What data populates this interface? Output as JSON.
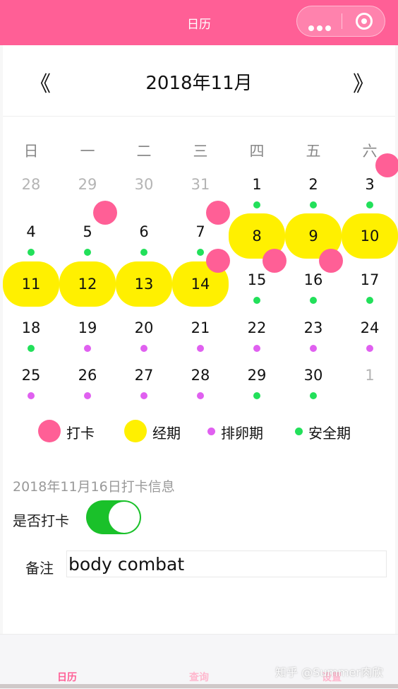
{
  "navbar": {
    "title": "日历",
    "bg": "#ff5f96"
  },
  "calendar": {
    "month_title": "2018年11月",
    "prev_arrow": "《",
    "next_arrow": "》",
    "weekdays": [
      "日",
      "一",
      "二",
      "三",
      "四",
      "五",
      "六"
    ],
    "days": [
      {
        "label": "28",
        "other": true
      },
      {
        "label": "29",
        "other": true
      },
      {
        "label": "30",
        "other": true
      },
      {
        "label": "31",
        "other": true
      },
      {
        "label": "1",
        "dot": "green"
      },
      {
        "label": "2",
        "dot": "green"
      },
      {
        "label": "3",
        "dot": "green",
        "mark": true
      },
      {
        "label": "4",
        "dot": "green"
      },
      {
        "label": "5",
        "dot": "green",
        "mark": true
      },
      {
        "label": "6",
        "dot": "green"
      },
      {
        "label": "7",
        "dot": "green",
        "mark": true
      },
      {
        "label": "8",
        "period": true
      },
      {
        "label": "9",
        "period": true
      },
      {
        "label": "10",
        "period": true
      },
      {
        "label": "11",
        "period": true
      },
      {
        "label": "12",
        "period": true
      },
      {
        "label": "13",
        "period": true
      },
      {
        "label": "14",
        "period": true,
        "mark": true
      },
      {
        "label": "15",
        "dot": "green",
        "mark": true
      },
      {
        "label": "16",
        "dot": "green",
        "mark": true
      },
      {
        "label": "17",
        "dot": "green"
      },
      {
        "label": "18",
        "dot": "green"
      },
      {
        "label": "19",
        "dot": "purple"
      },
      {
        "label": "20",
        "dot": "purple"
      },
      {
        "label": "21",
        "dot": "purple"
      },
      {
        "label": "22",
        "dot": "purple"
      },
      {
        "label": "23",
        "dot": "purple"
      },
      {
        "label": "24",
        "dot": "purple"
      },
      {
        "label": "25",
        "dot": "purple"
      },
      {
        "label": "26",
        "dot": "purple"
      },
      {
        "label": "27",
        "dot": "purple"
      },
      {
        "label": "28",
        "dot": "purple"
      },
      {
        "label": "29",
        "dot": "green"
      },
      {
        "label": "30",
        "dot": "green"
      },
      {
        "label": "1",
        "other": true
      }
    ]
  },
  "legend": [
    {
      "label": "打卡",
      "color": "#ff5f96",
      "size": "large"
    },
    {
      "label": "经期",
      "color": "#fff000",
      "size": "large"
    },
    {
      "label": "排卵期",
      "color": "#e060f0",
      "size": "small"
    },
    {
      "label": "安全期",
      "color": "#22e05a",
      "size": "small"
    }
  ],
  "info": {
    "title": "2018年11月16日打卡信息",
    "checkin_label": "是否打卡",
    "checkin_on": true,
    "remark_label": "备注",
    "remark_value": "body combat"
  },
  "tabbar": {
    "tabs": [
      {
        "label": "日历",
        "active": true
      },
      {
        "label": "查询",
        "active": false
      },
      {
        "label": "设置",
        "active": false
      }
    ]
  },
  "watermark": "知乎 @Summer肉欣"
}
